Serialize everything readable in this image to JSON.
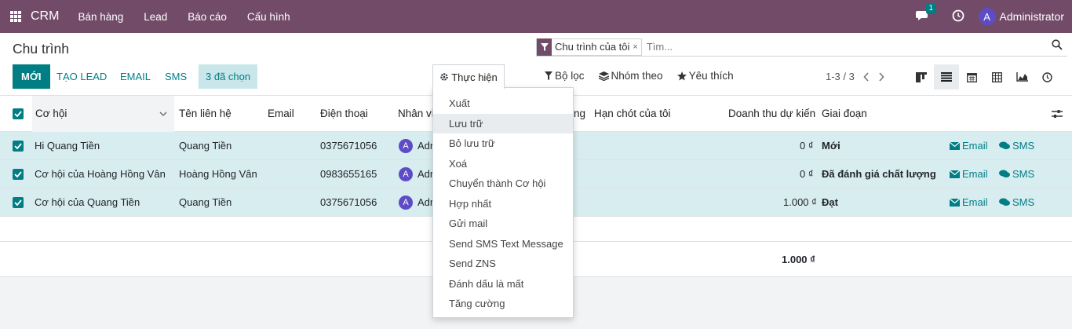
{
  "topnav": {
    "brand": "CRM",
    "menu": [
      "Bán hàng",
      "Lead",
      "Báo cáo",
      "Cấu hình"
    ],
    "chat_badge": "1",
    "user_initial": "A",
    "user_name": "Administrator",
    "bg_color": "#714b67"
  },
  "control": {
    "breadcrumb": "Chu trình",
    "new_label": "MỚI",
    "create_lead_label": "TẠO LEAD",
    "email_label": "EMAIL",
    "sms_label": "SMS",
    "selected_label": "3 đã chọn",
    "action_label": "Thực hiện",
    "search": {
      "facet": "Chu trình của tôi",
      "facet_remove": "×",
      "placeholder": "Tìm..."
    },
    "filter_label": "Bộ lọc",
    "groupby_label": "Nhóm theo",
    "favorite_label": "Yêu thích",
    "pager": "1-3 / 3",
    "views": [
      "kanban-icon",
      "list-icon",
      "calendar-icon",
      "pivot-icon",
      "graph-icon",
      "activity-icon"
    ],
    "accent_color": "#017e84"
  },
  "table": {
    "columns": [
      "Cơ hội",
      "Tên liên hệ",
      "Email",
      "Điện thoại",
      "Nhân viên",
      "Hoạt động",
      "Hạn chót của tôi",
      "Doanh thu dự kiến",
      "Giai đoạn"
    ],
    "visible_headers": {
      "opportunity": "Cơ hội",
      "contact": "Tên liên hệ",
      "email": "Email",
      "phone": "Điện thoại",
      "salesperson": "Nhân vi",
      "activity": "ng",
      "deadline": "Hạn chót của tôi",
      "revenue": "Doanh thu dự kiến",
      "stage": "Giai đoạn"
    },
    "rows": [
      {
        "opportunity": "Hi Quang Tiền",
        "contact": "Quang Tiền",
        "phone": "0375671056",
        "user_initial": "A",
        "user": "Adm",
        "revenue": "0 ₫",
        "stage": "Mới",
        "email_btn": "Email",
        "sms_btn": "SMS"
      },
      {
        "opportunity": "Cơ hội của Hoàng Hồng Vân",
        "contact": "Hoàng Hồng Vân",
        "phone": "0983655165",
        "user_initial": "A",
        "user": "Adm",
        "revenue": "0 ₫",
        "stage": "Đã đánh giá chất lượng",
        "email_btn": "Email",
        "sms_btn": "SMS"
      },
      {
        "opportunity": "Cơ hội của Quang Tiền",
        "contact": "Quang Tiền",
        "phone": "0375671056",
        "user_initial": "A",
        "user": "Adm",
        "revenue": "1.000 ₫",
        "stage": "Đạt",
        "email_btn": "Email",
        "sms_btn": "SMS"
      }
    ],
    "total_revenue": "1.000 ₫",
    "selected_row_color": "#d8edf0"
  },
  "action_menu": {
    "items": [
      "Xuất",
      "Lưu trữ",
      "Bỏ lưu trữ",
      "Xoá",
      "Chuyển thành Cơ hội",
      "Hợp nhất",
      "Gửi mail",
      "Send SMS Text Message",
      "Send ZNS",
      "Đánh dấu là mất",
      "Tăng cường"
    ],
    "hovered_item": "Lưu trữ"
  }
}
